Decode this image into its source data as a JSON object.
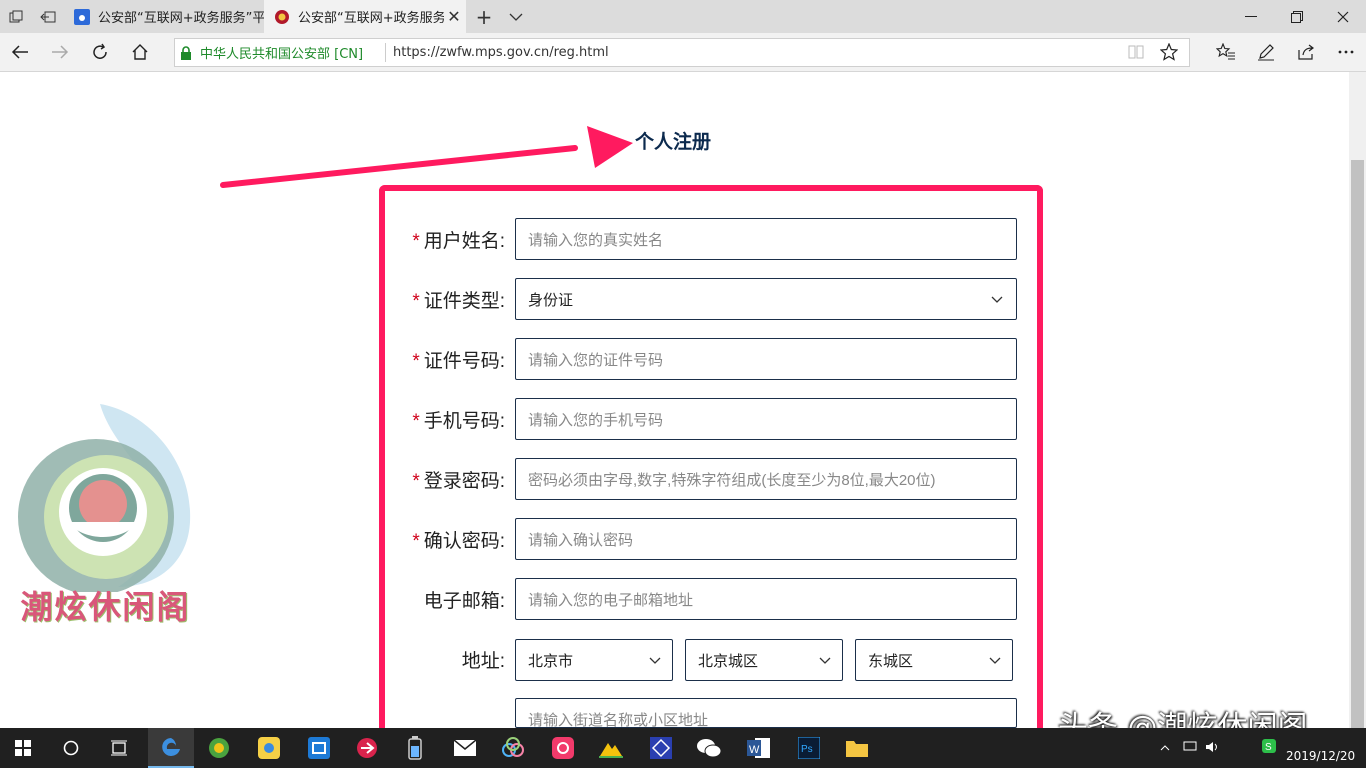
{
  "browser": {
    "tabs": [
      {
        "title": "公安部“互联网+政务服务”平",
        "active": false
      },
      {
        "title": "公安部“互联网+政务服务",
        "active": true
      }
    ],
    "cert_label": "中华人民共和国公安部 [CN]",
    "url": "https://zwfw.mps.gov.cn/reg.html"
  },
  "page": {
    "title": "个人注册",
    "form": {
      "fields": [
        {
          "label": "用户姓名:",
          "required": true,
          "placeholder": "请输入您的真实姓名"
        },
        {
          "label": "证件类型:",
          "required": true,
          "value": "身份证"
        },
        {
          "label": "证件号码:",
          "required": true,
          "placeholder": "请输入您的证件号码"
        },
        {
          "label": "手机号码:",
          "required": true,
          "placeholder": "请输入您的手机号码"
        },
        {
          "label": "登录密码:",
          "required": true,
          "placeholder": "密码必须由字母,数字,特殊字符组成(长度至少为8位,最大20位)"
        },
        {
          "label": "确认密码:",
          "required": true,
          "placeholder": "请输入确认密码"
        },
        {
          "label": "电子邮箱:",
          "required": false,
          "placeholder": "请输入您的电子邮箱地址"
        }
      ],
      "required_mark": "*",
      "address": {
        "label": "地址:",
        "province": "北京市",
        "city": "北京城区",
        "district": "东城区",
        "street_placeholder": "请输入街道名称或小区地址"
      }
    }
  },
  "watermark": {
    "text": "潮炫休闲阁"
  },
  "overlay": {
    "text": "头条 @潮炫休闲阁"
  },
  "taskbar": {
    "date": "2019/12/20"
  },
  "colors": {
    "accent": "#ff1a5f",
    "title": "#0c2a4e",
    "required": "#d0021b"
  }
}
